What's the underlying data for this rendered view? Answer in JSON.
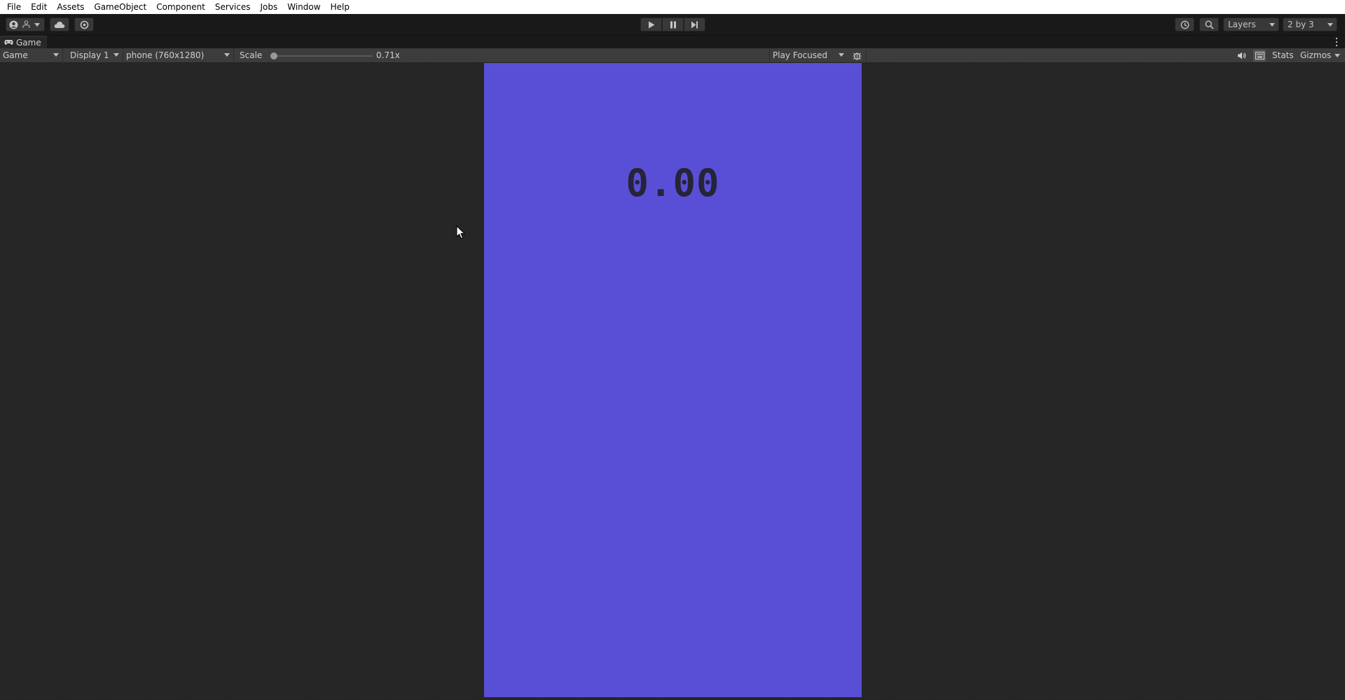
{
  "menu": [
    "File",
    "Edit",
    "Assets",
    "GameObject",
    "Component",
    "Services",
    "Jobs",
    "Window",
    "Help"
  ],
  "toolbar": {
    "account_icon": "account-icon",
    "collab_icon": "collab-icon",
    "cloud_icon": "cloud-icon",
    "settings_icon": "gear-icon",
    "play_icon": "play-icon",
    "pause_icon": "pause-icon",
    "step_icon": "step-icon",
    "history_icon": "history-icon",
    "search_icon": "search-icon",
    "layers_label": "Layers",
    "layout_label": "2 by 3"
  },
  "tab": {
    "title": "Game",
    "icon": "gamepad-icon"
  },
  "gamebar": {
    "mode_label": "Game",
    "display_label": "Display 1",
    "resolution_label": "phone (760x1280)",
    "scale_label": "Scale",
    "scale_value": "0.71x",
    "scale_fraction": 0.0,
    "play_mode_label": "Play Focused",
    "stats_label": "Stats",
    "gizmos_label": "Gizmos"
  },
  "game": {
    "score": "0.00",
    "background_color": "#594fd7"
  }
}
